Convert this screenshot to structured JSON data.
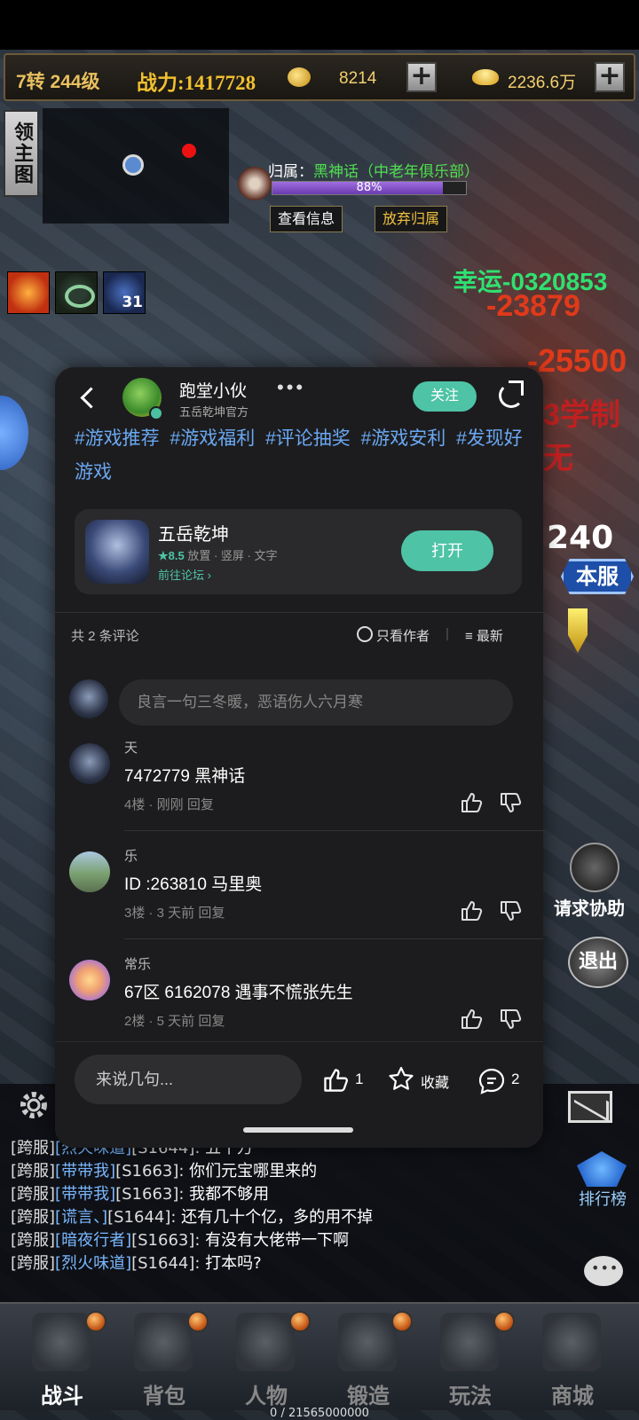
{
  "hud": {
    "level": "7转 244级",
    "power": "战力:1417728",
    "coins": "8214",
    "gold": "2236.6万",
    "plus": "+",
    "minimap_button": "领主图",
    "owner_label": "归属：",
    "owner_name": "黑神话（中老年俱乐部）",
    "owner_progress": "88%",
    "owner_progress_value": 0.88,
    "view_info": "查看信息",
    "give_up": "放弃归属",
    "buff_count": "31",
    "luck_text": "幸运-0320853",
    "damage_1": "-23879",
    "damage_2": "-25500",
    "damage_3": "3学制无",
    "boss_count": "240",
    "server_badge": "本服",
    "help_label": "请求协助",
    "exit_label": "退出",
    "rank_label": "排行榜",
    "exp": "0 / 21565000000"
  },
  "dialog": {
    "author_name": "跑堂小伙",
    "author_sub": "五岳乾坤官方",
    "more": "•••",
    "follow": "关注",
    "hashtags": [
      "#游戏推荐",
      "#游戏福利",
      "#评论抽奖",
      "#游戏安利",
      "#发现好游戏"
    ],
    "game": {
      "name": "五岳乾坤",
      "rating": "★8.5",
      "tags": "放置 · 竖屏 · 文字",
      "forum": "前往论坛 ›",
      "open": "打开"
    },
    "comment_count": "共 2 条评论",
    "author_only": "只看作者",
    "sort_sep": "|",
    "sort": "≡ 最新",
    "input_placeholder": "良言一句三冬暖，恶语伤人六月寒",
    "comments": [
      {
        "name": "天",
        "text": "7472779    黑神话",
        "meta": "4楼 · 刚刚  回复"
      },
      {
        "name": "乐",
        "text": "ID :263810  马里奥",
        "meta": "3楼 · 3 天前  回复"
      },
      {
        "name": "常乐",
        "text": "67区 6162078 遇事不慌张先生",
        "meta": "2楼 · 5 天前  回复"
      }
    ],
    "say_placeholder": "来说几句...",
    "likes": "1",
    "favorite": "收藏",
    "comments_total": "2"
  },
  "chat": [
    {
      "tag": "[跨服]",
      "name": "[烈火味道]",
      "server": "[S1644]:",
      "msg": " 五千万"
    },
    {
      "tag": "[跨服]",
      "name": "[带带我]",
      "server": "[S1663]:",
      "msg": " 你们元宝哪里来的"
    },
    {
      "tag": "[跨服]",
      "name": "[带带我]",
      "server": "[S1663]:",
      "msg": " 我都不够用"
    },
    {
      "tag": "[跨服]",
      "name": "[谎言、]",
      "server": "[S1644]:",
      "msg": " 还有几十个亿，多的用不掉"
    },
    {
      "tag": "[跨服]",
      "name": "[暗夜行者]",
      "server": "[S1663]:",
      "msg": " 有没有大佬带一下啊"
    },
    {
      "tag": "[跨服]",
      "name": "[烈火味道]",
      "server": "[S1644]:",
      "msg": " 打本吗?"
    }
  ],
  "nav": [
    {
      "label": "战斗"
    },
    {
      "label": "背包"
    },
    {
      "label": "人物"
    },
    {
      "label": "锻造"
    },
    {
      "label": "玩法"
    },
    {
      "label": "商城"
    }
  ],
  "colors": {
    "accent": "#4ec3a6",
    "hashtag": "#6aa8f2",
    "owner_green": "#4ee04e",
    "damage_red": "#e03a1a",
    "power_gold": "#f0c030"
  }
}
